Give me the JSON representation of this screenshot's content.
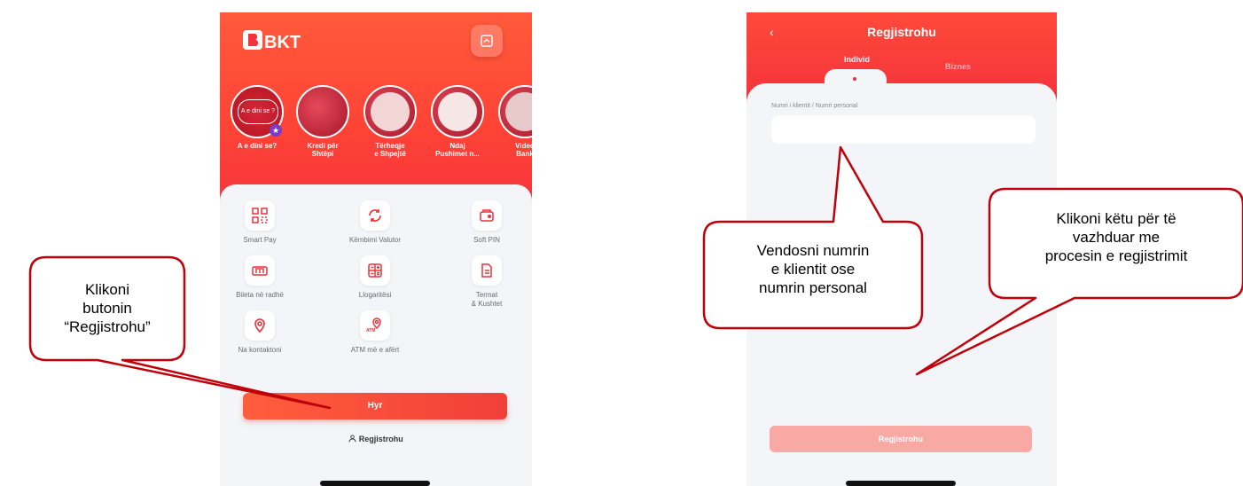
{
  "phone1": {
    "logo_text": "BKT",
    "stories": [
      {
        "label": "A e dini se?",
        "inset": "A e dini se ?"
      },
      {
        "label": "Kredi për\nShtëpi"
      },
      {
        "label": "Tërheqje\ne Shpejtë"
      },
      {
        "label": "Ndaj\nPushimet n..."
      },
      {
        "label": "Video\nBank"
      }
    ],
    "grid": [
      {
        "label": "Smart Pay"
      },
      {
        "label": "Këmbimi Valutor"
      },
      {
        "label": "Soft PIN"
      },
      {
        "label": "Bileta në radhë"
      },
      {
        "label": "Llogaritësi"
      },
      {
        "label": "Termat\n& Kushtet"
      },
      {
        "label": "Na kontaktoni"
      },
      {
        "label": "ATM më e afërt"
      }
    ],
    "login_button": "Hyr",
    "register_link": "Regjistrohu"
  },
  "phone2": {
    "title": "Regjistrohu",
    "tabs": [
      "Individ",
      "Biznes"
    ],
    "field_label": "Numri i klientit / Numri personal",
    "field_value": "",
    "register_button": "Regjistrohu"
  },
  "callouts": {
    "c1": "Klikoni\nbutonin\n“Regjistrohu”",
    "c2": "Vendosni numrin\ne klientit ose\nnumrin personal",
    "c3": "Klikoni këtu për të\nvazhduar me\nprocesin e regjistrimit"
  },
  "colors": {
    "brand_red": "#f2303c",
    "callout_border": "#c0000a"
  }
}
